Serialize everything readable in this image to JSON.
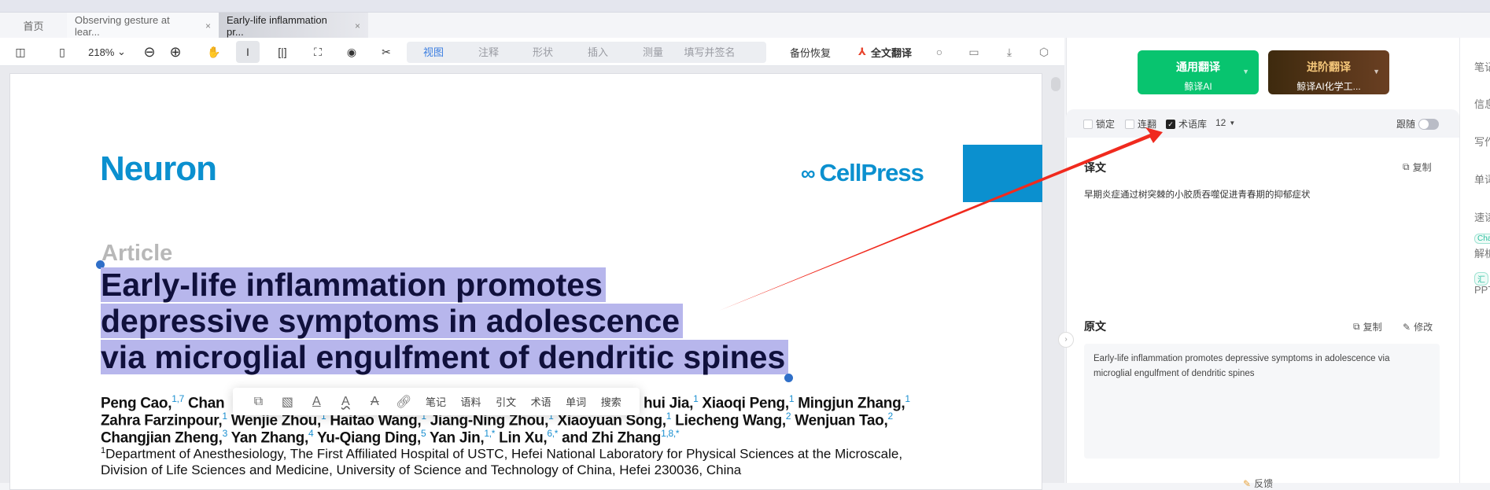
{
  "tabs": [
    {
      "label": "首页"
    },
    {
      "label": "Observing gesture at lear...",
      "close": "×"
    },
    {
      "label": "Early-life inflammation pr...",
      "close": "×",
      "active": true
    }
  ],
  "toolbar": {
    "zoom": "218%",
    "view_tabs": [
      "视图",
      "注释",
      "形状",
      "插入",
      "测量",
      "填写并签名"
    ],
    "active_view": "视图",
    "backup": "备份恢复",
    "full_translate": "全文翻译"
  },
  "document": {
    "journal": "Neuron",
    "publisher": "CellPress",
    "article_type": "Article",
    "title_lines": [
      "Early-life inflammation promotes",
      "depressive symptoms in adolescence",
      "via microglial engulfment of dendritic spines"
    ],
    "authors": {
      "l1a": "Peng Cao,",
      "l1a_sup": "1,7",
      "l1b": "Chan",
      "l1c": "hui Jia,",
      "l1c_sup": "1",
      "l1d": "Xiaoqi Peng,",
      "l1d_sup": "1",
      "l1e": "Mingjun Zhang,",
      "l1e_sup": "1",
      "l2": [
        [
          "Zahra Farzinpour,",
          "1"
        ],
        [
          "Wenjie Zhou,",
          "1"
        ],
        [
          "Haitao Wang,",
          "1"
        ],
        [
          "Jiang-Ning Zhou,",
          "1"
        ],
        [
          "Xiaoyuan Song,",
          "1"
        ],
        [
          "Liecheng Wang,",
          "2"
        ],
        [
          "Wenjuan Tao,",
          "2"
        ]
      ],
      "l3": [
        [
          "Changjian Zheng,",
          "3"
        ],
        [
          "Yan Zhang,",
          "4"
        ],
        [
          "Yu-Qiang Ding,",
          "5"
        ],
        [
          "Yan Jin,",
          "1,*"
        ],
        [
          "Lin Xu,",
          "6,*"
        ],
        [
          "and Zhi Zhang",
          "1,8,*"
        ]
      ]
    },
    "affiliation_sup": "1",
    "affiliation_lines": [
      "Department of Anesthesiology, The First Affiliated Hospital of USTC, Hefei National Laboratory for Physical Sciences at the Microscale,",
      "Division of Life Sciences and Medicine, University of Science and Technology of China, Hefei 230036, China"
    ]
  },
  "popup": {
    "items": [
      "笔记",
      "语料",
      "引文",
      "术语",
      "单词",
      "搜索"
    ]
  },
  "translate": {
    "general": {
      "title": "通用翻译",
      "engine": "鲸译AI"
    },
    "advanced": {
      "title": "进阶翻译",
      "engine": "鲸译AI化学工..."
    },
    "options": {
      "lock": "锁定",
      "continuous": "连翻",
      "termbase": "术语库",
      "font_size": "12",
      "follow": "跟随"
    },
    "translation_label": "译文",
    "copy": "复制",
    "translation": "早期炎症通过树突棘的小胶质吞噬促进青春期的抑郁症状",
    "source_label": "原文",
    "edit": "修改",
    "source": "Early-life inflammation promotes depressive symptoms in adolescence via microglial engulfment of dendritic spines",
    "feedback": "反馈"
  },
  "right_strip": [
    "笔记",
    "信息",
    "写作",
    "单词",
    "速读",
    "Chat",
    "解析",
    "汇",
    "PPT"
  ],
  "colors": {
    "accent": "#3a7de0",
    "general_btn": "#08c46f",
    "advanced_btn": "#4a3210",
    "highlight": "#b7b6ec",
    "annotation_arrow": "#f02a1e"
  }
}
